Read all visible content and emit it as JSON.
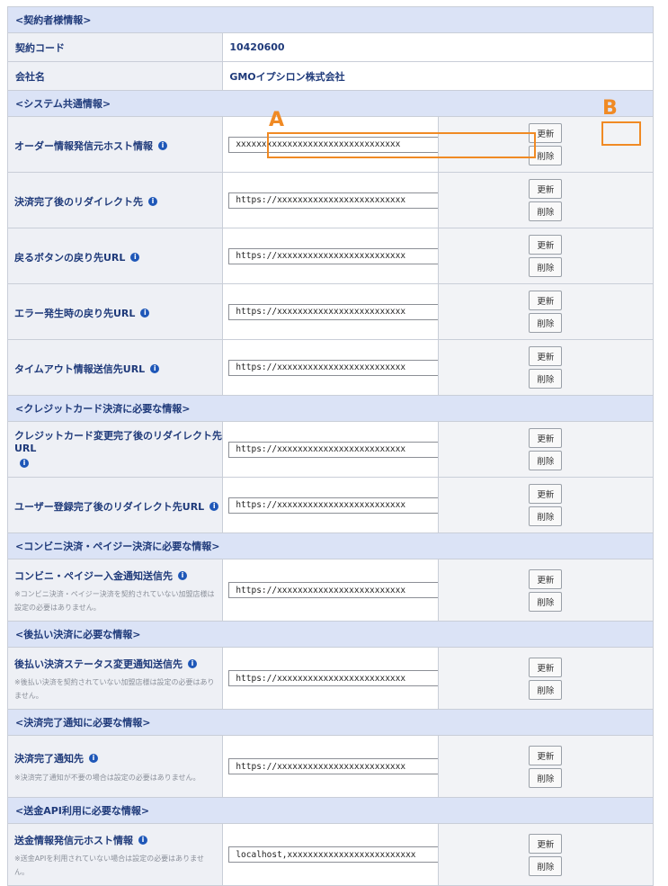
{
  "contract": {
    "section_title": "<契約者様情報>",
    "code_label": "契約コード",
    "code_value": "10420600",
    "company_label": "会社名",
    "company_value": "GMOイプシロン株式会社"
  },
  "buttons": {
    "update": "更新",
    "delete": "削除"
  },
  "info_icon": "info-icon",
  "sections": [
    {
      "title": "<システム共通情報>",
      "rows": [
        {
          "label": "オーダー情報発信元ホスト情報",
          "value": "xxxxxxxxxxxxxxxxxxxxxxxxxxxxxxxx"
        },
        {
          "label": "決済完了後のリダイレクト先",
          "value": "https://xxxxxxxxxxxxxxxxxxxxxxxxx"
        },
        {
          "label": "戻るボタンの戻り先URL",
          "value": "https://xxxxxxxxxxxxxxxxxxxxxxxxx"
        },
        {
          "label": "エラー発生時の戻り先URL",
          "value": "https://xxxxxxxxxxxxxxxxxxxxxxxxx"
        },
        {
          "label": "タイムアウト情報送信先URL",
          "value": "https://xxxxxxxxxxxxxxxxxxxxxxxxx"
        }
      ]
    },
    {
      "title": "<クレジットカード決済に必要な情報>",
      "rows": [
        {
          "label": "クレジットカード変更完了後のリダイレクト先URL",
          "value": "https://xxxxxxxxxxxxxxxxxxxxxxxxx"
        },
        {
          "label": "ユーザー登録完了後のリダイレクト先URL",
          "value": "https://xxxxxxxxxxxxxxxxxxxxxxxxx"
        }
      ]
    },
    {
      "title": "<コンビニ決済・ペイジー決済に必要な情報>",
      "rows": [
        {
          "label": "コンビニ・ペイジー入金通知送信先",
          "note": "※コンビニ決済・ペイジー決済を契約されていない加盟店様は設定の必要はありません。",
          "value": "https://xxxxxxxxxxxxxxxxxxxxxxxxx"
        }
      ]
    },
    {
      "title": "<後払い決済に必要な情報>",
      "rows": [
        {
          "label": "後払い決済ステータス変更通知送信先",
          "note": "※後払い決済を契約されていない加盟店様は設定の必要はありません。",
          "value": "https://xxxxxxxxxxxxxxxxxxxxxxxxx"
        }
      ]
    },
    {
      "title": "<決済完了通知に必要な情報>",
      "rows": [
        {
          "label": "決済完了通知先",
          "note": "※決済完了通知が不要の場合は設定の必要はありません。",
          "value": "https://xxxxxxxxxxxxxxxxxxxxxxxxx"
        }
      ]
    },
    {
      "title": "<送金API利用に必要な情報>",
      "rows": [
        {
          "label": "送金情報発信元ホスト情報",
          "note": "※送金APIを利用されていない場合は設定の必要はありません。",
          "value": "localhost,xxxxxxxxxxxxxxxxxxxxxxxxx"
        }
      ]
    }
  ],
  "annotations": {
    "a": "A",
    "b": "B",
    "color": "#f08a24"
  }
}
